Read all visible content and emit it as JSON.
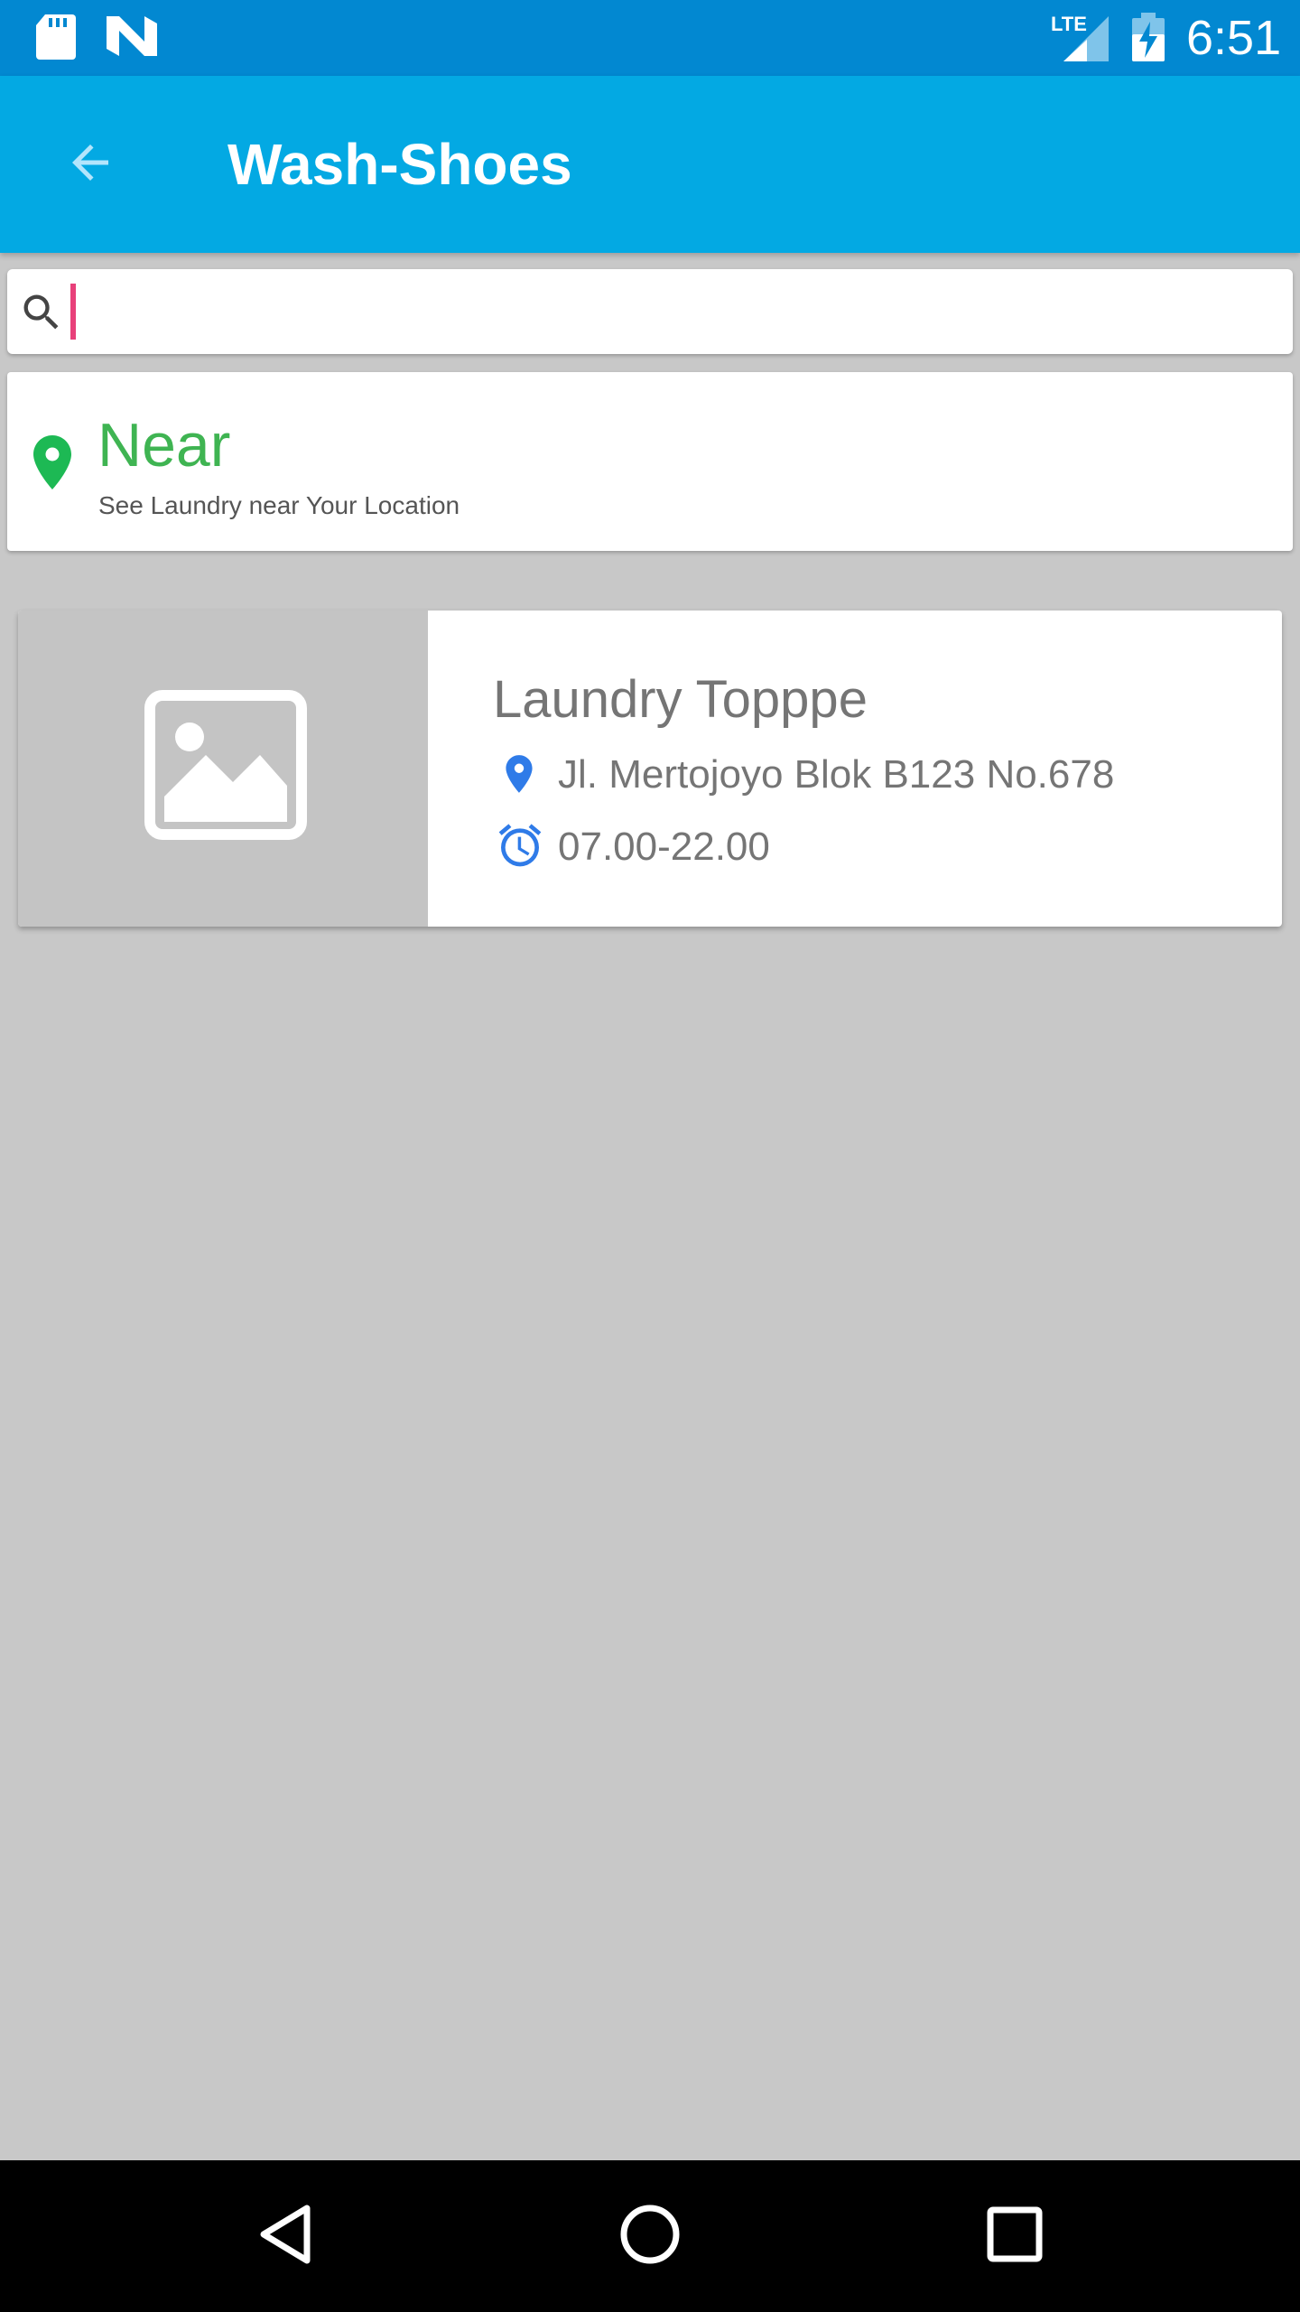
{
  "status_bar": {
    "time": "6:51",
    "network": "LTE"
  },
  "app_bar": {
    "title": "Wash-Shoes",
    "color": "#03a9e3"
  },
  "search": {
    "value": "",
    "placeholder": ""
  },
  "near": {
    "title": "Near",
    "subtitle": "See Laundry near Your Location",
    "accent_color": "#3fb452"
  },
  "laundries": [
    {
      "name": "Laundry Topppe",
      "address": "Jl. Mertojoyo Blok B123 No.678",
      "hours": "07.00-22.00"
    }
  ],
  "icons": {
    "status_left": [
      "sd-card-icon",
      "n-icon"
    ],
    "status_right": [
      "lte-signal-icon",
      "battery-charging-icon"
    ],
    "app_bar": [
      "arrow-back-icon"
    ],
    "search": [
      "search-icon"
    ],
    "near": [
      "location-pin-icon"
    ],
    "laundry_item": [
      "image-placeholder-icon",
      "location-pin-icon",
      "alarm-clock-icon"
    ],
    "nav_bar": [
      "nav-back-icon",
      "nav-home-icon",
      "nav-recents-icon"
    ]
  },
  "colors": {
    "status_bar": "#0288d1",
    "background": "#c8c8c8",
    "cursor": "#e8407a",
    "detail_icon": "#2f7be8"
  }
}
